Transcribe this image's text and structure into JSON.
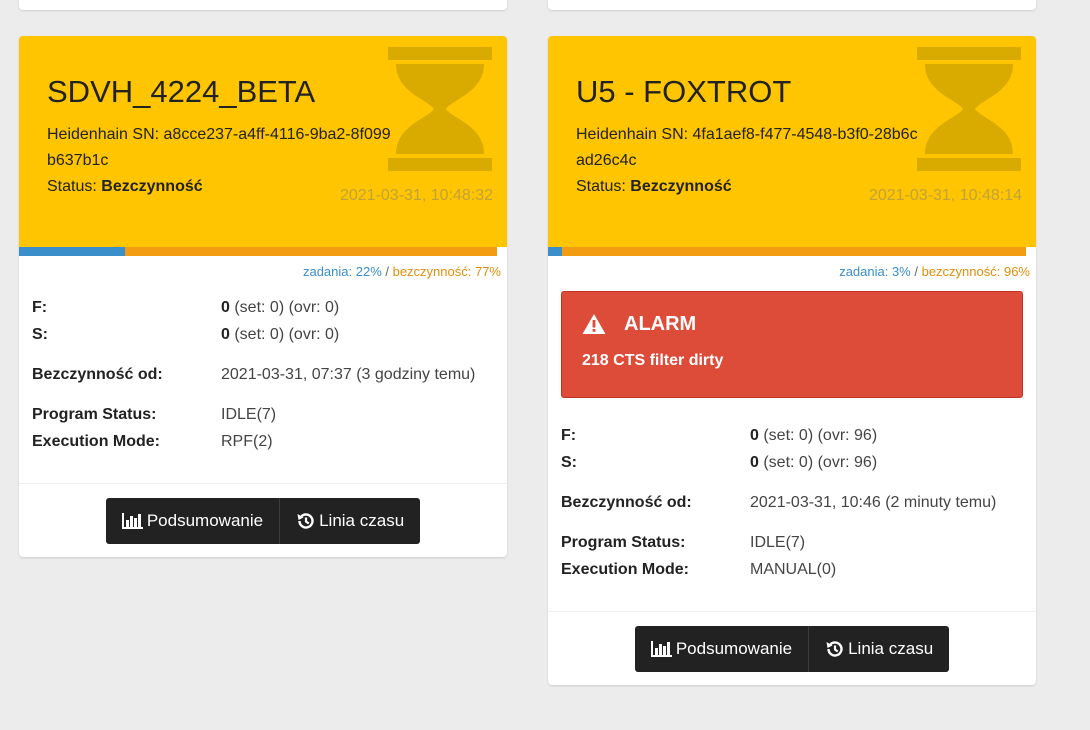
{
  "cards": [
    {
      "title": "SDVH_4224_BETA",
      "sn": "Heidenhain SN: a8cce237-a4ff-4116-9ba2-8f099b637b1c",
      "status_label": "Status:",
      "status_value": "Bezczynność",
      "timestamp": "2021-03-31, 10:48:32",
      "busy_fraction": 0.22,
      "idle_fraction": 0.77,
      "legend_busy": "zadania: 22%",
      "legend_sep": " / ",
      "legend_idle": "bezczynność: 77%",
      "f_label": "F:",
      "f_count": "0",
      "f_detail": " (set: 0) (ovr: 0)",
      "s_label": "S:",
      "s_count": "0",
      "s_detail": " (set: 0) (ovr: 0)",
      "idle_since_label": "Bezczynność od:",
      "idle_since_value": "2021-03-31, 07:37 (3 godziny temu)",
      "program_status_label": "Program Status:",
      "program_status_value": "IDLE(7)",
      "exec_mode_label": "Execution Mode:",
      "exec_mode_value": "RPF(2)",
      "btn_summary": "Podsumowanie",
      "btn_timeline": "Linia czasu"
    },
    {
      "title": "U5 - FOXTROT",
      "sn": "Heidenhain SN: 4fa1aef8-f477-4548-b3f0-28b6cad26c4c",
      "status_label": "Status:",
      "status_value": "Bezczynność",
      "timestamp": "2021-03-31, 10:48:14",
      "busy_fraction": 0.03,
      "idle_fraction": 0.96,
      "legend_busy": "zadania: 3%",
      "legend_sep": " / ",
      "legend_idle": "bezczynność: 96%",
      "alarm_title": "ALARM",
      "alarm_text": "218 CTS filter dirty",
      "f_label": "F:",
      "f_count": "0",
      "f_detail": " (set: 0) (ovr: 96)",
      "s_label": "S:",
      "s_count": "0",
      "s_detail": " (set: 0) (ovr: 96)",
      "idle_since_label": "Bezczynność od:",
      "idle_since_value": "2021-03-31, 10:46 (2 minuty temu)",
      "program_status_label": "Program Status:",
      "program_status_value": "IDLE(7)",
      "exec_mode_label": "Execution Mode:",
      "exec_mode_value": "MANUAL(0)",
      "btn_summary": "Podsumowanie",
      "btn_timeline": "Linia czasu"
    }
  ],
  "colors": {
    "header": "#fec500",
    "busy": "#3a8ec9",
    "idle": "#f39c12",
    "alarm": "#dd4b39",
    "button": "#222222"
  },
  "icons": {
    "header": "hourglass-icon",
    "alarm": "warning-icon",
    "summary": "bar-chart-icon",
    "timeline": "history-icon"
  }
}
